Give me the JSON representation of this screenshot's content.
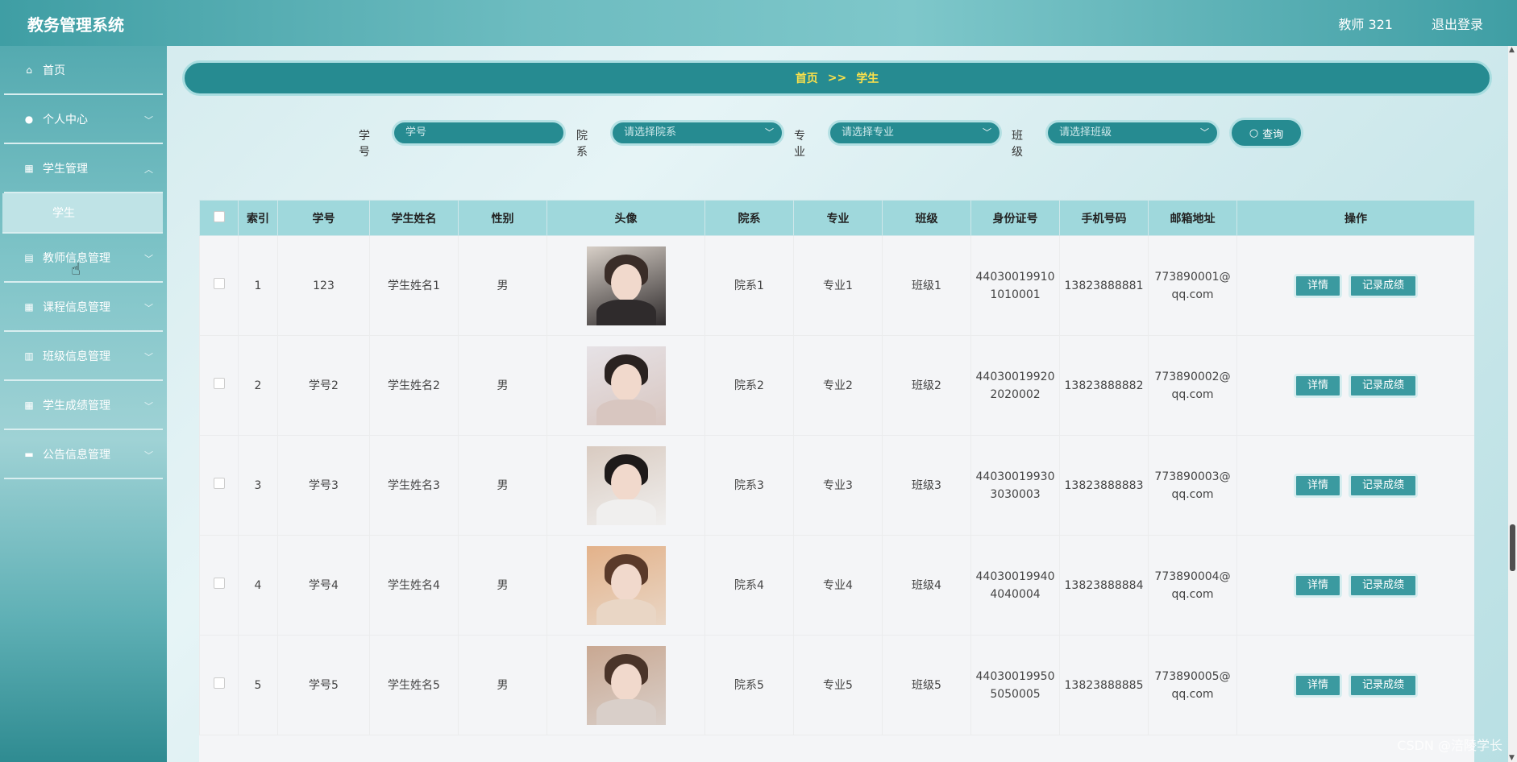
{
  "app": {
    "title": "教务管理系统",
    "user": "教师 321",
    "logout": "退出登录"
  },
  "sidebar": {
    "items": [
      {
        "label": "首页",
        "icon": "home-icon",
        "glyph": "⌂",
        "expandable": false
      },
      {
        "label": "个人中心",
        "icon": "user-icon",
        "glyph": "●",
        "expandable": true
      },
      {
        "label": "学生管理",
        "icon": "grid-icon",
        "glyph": "▦",
        "expandable": true,
        "sub": "学生"
      },
      {
        "label": "教师信息管理",
        "icon": "teacher-icon",
        "glyph": "▤",
        "expandable": true
      },
      {
        "label": "课程信息管理",
        "icon": "grid-icon",
        "glyph": "▦",
        "expandable": true
      },
      {
        "label": "班级信息管理",
        "icon": "table-icon",
        "glyph": "▥",
        "expandable": true
      },
      {
        "label": "学生成绩管理",
        "icon": "grid-icon",
        "glyph": "▦",
        "expandable": true
      },
      {
        "label": "公告信息管理",
        "icon": "briefcase-icon",
        "glyph": "▬",
        "expandable": true
      }
    ]
  },
  "breadcrumb": {
    "home": "首页",
    "sep": ">>",
    "current": "学生"
  },
  "search": {
    "student_no_label": "学号",
    "student_no_placeholder": "学号",
    "dept_label": "院系",
    "dept_placeholder": "请选择院系",
    "major_label": "专业",
    "major_placeholder": "请选择专业",
    "class_label": "班级",
    "class_placeholder": "请选择班级",
    "button": "查询"
  },
  "table": {
    "headers": [
      "",
      "索引",
      "学号",
      "学生姓名",
      "性别",
      "头像",
      "院系",
      "专业",
      "班级",
      "身份证号",
      "手机号码",
      "邮箱地址",
      "操作"
    ],
    "rows": [
      {
        "index": "1",
        "no": "123",
        "name": "学生姓名1",
        "gender": "男",
        "dept": "院系1",
        "major": "专业1",
        "cls": "班级1",
        "id1": "44030019910",
        "id2": "1010001",
        "phone": "13823888881",
        "email1": "773890001@",
        "email2": "qq.com"
      },
      {
        "index": "2",
        "no": "学号2",
        "name": "学生姓名2",
        "gender": "男",
        "dept": "院系2",
        "major": "专业2",
        "cls": "班级2",
        "id1": "44030019920",
        "id2": "2020002",
        "phone": "13823888882",
        "email1": "773890002@",
        "email2": "qq.com"
      },
      {
        "index": "3",
        "no": "学号3",
        "name": "学生姓名3",
        "gender": "男",
        "dept": "院系3",
        "major": "专业3",
        "cls": "班级3",
        "id1": "44030019930",
        "id2": "3030003",
        "phone": "13823888883",
        "email1": "773890003@",
        "email2": "qq.com"
      },
      {
        "index": "4",
        "no": "学号4",
        "name": "学生姓名4",
        "gender": "男",
        "dept": "院系4",
        "major": "专业4",
        "cls": "班级4",
        "id1": "44030019940",
        "id2": "4040004",
        "phone": "13823888884",
        "email1": "773890004@",
        "email2": "qq.com"
      },
      {
        "index": "5",
        "no": "学号5",
        "name": "学生姓名5",
        "gender": "男",
        "dept": "院系5",
        "major": "专业5",
        "cls": "班级5",
        "id1": "44030019950",
        "id2": "5050005",
        "phone": "13823888885",
        "email1": "773890005@",
        "email2": "qq.com"
      }
    ],
    "detail_button": "详情",
    "record_button": "记录成绩"
  },
  "watermark": "CSDN @涪陵学长"
}
